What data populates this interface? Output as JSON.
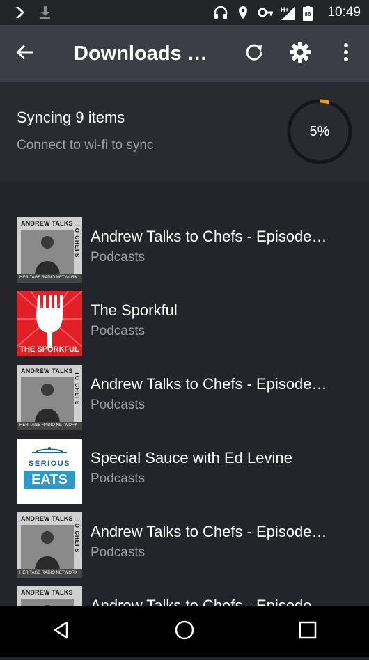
{
  "status_bar": {
    "time": "10:49",
    "battery_level": "86",
    "network_label": "H+",
    "left_icons": [
      "chevron-right-icon",
      "download-icon"
    ],
    "right_icons": [
      "headphones-icon",
      "location-pin-icon",
      "vpn-key-icon",
      "signal-icon",
      "battery-icon"
    ]
  },
  "app_bar": {
    "title": "Downloads &…",
    "icons": [
      "back-arrow-icon",
      "refresh-icon",
      "settings-gear-icon",
      "overflow-menu-icon"
    ]
  },
  "sync": {
    "title": "Syncing 9 items",
    "subtitle": "Connect to wi-fi to sync",
    "progress_label": "5%",
    "progress_value": 0.05,
    "progress_color": "#f0a21b"
  },
  "items": [
    {
      "title": "Andrew Talks to Chefs - Episode…",
      "subtitle": "Podcasts",
      "art": "andrew-talks-to-chefs"
    },
    {
      "title": "The Sporkful",
      "subtitle": "Podcasts",
      "art": "the-sporkful"
    },
    {
      "title": "Andrew Talks to Chefs - Episode…",
      "subtitle": "Podcasts",
      "art": "andrew-talks-to-chefs"
    },
    {
      "title": "Special Sauce with Ed Levine",
      "subtitle": "Podcasts",
      "art": "serious-eats"
    },
    {
      "title": "Andrew Talks to Chefs - Episode…",
      "subtitle": "Podcasts",
      "art": "andrew-talks-to-chefs"
    },
    {
      "title": "Andrew Talks to Chefs - Episode…",
      "subtitle": "",
      "art": "andrew-talks-to-chefs"
    }
  ],
  "art_text": {
    "andrew_header": "ANDREW TALKS",
    "andrew_vertical": "TO CHEFS",
    "andrew_footer": "HERITAGE RADIO NETWORK",
    "sporkful_label": "THE SPORKFUL",
    "serious_eats_top": "SERIOUS",
    "serious_eats_bottom": "EATS"
  },
  "nav_bar": {
    "icons": [
      "nav-back-icon",
      "nav-home-icon",
      "nav-recents-icon"
    ]
  }
}
